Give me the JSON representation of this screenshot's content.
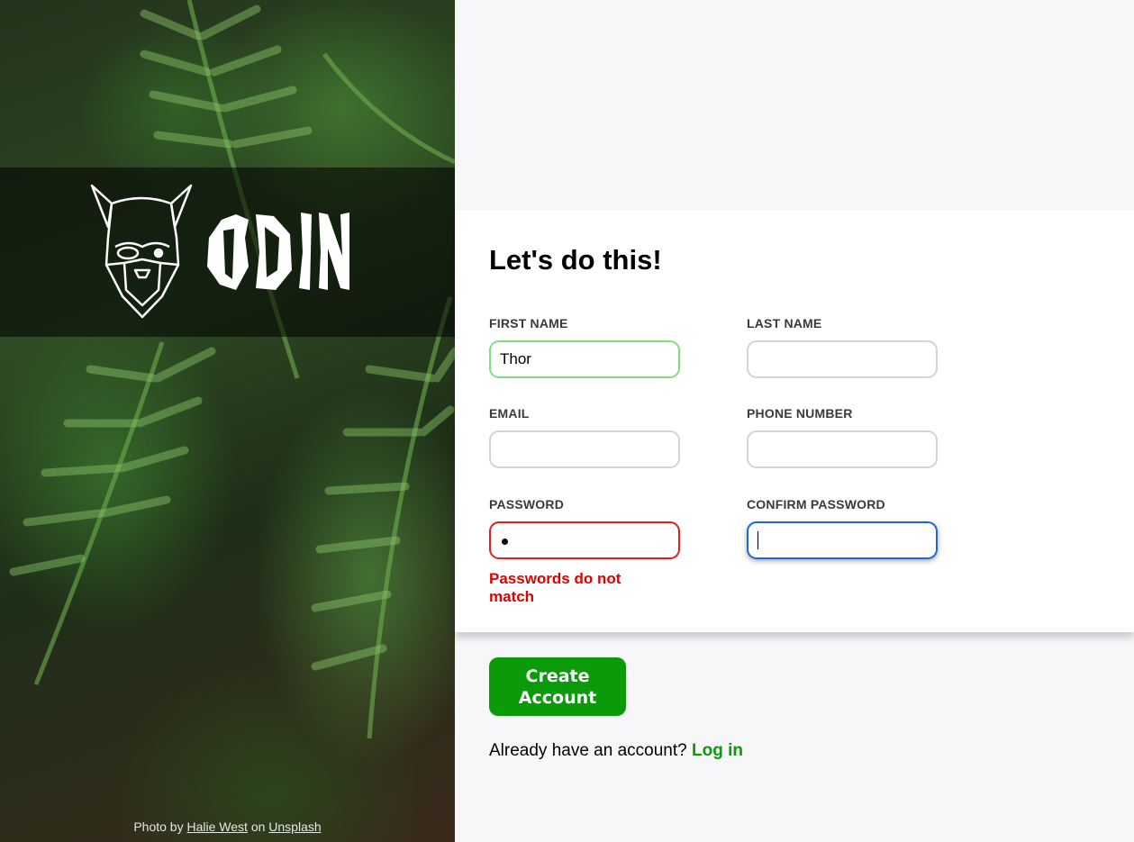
{
  "brand": {
    "name": "ODIN"
  },
  "photo_credit": {
    "prefix": "Photo by",
    "author": "Halie West",
    "middle": "on",
    "site": "Unsplash"
  },
  "form": {
    "heading": "Let's do this!",
    "fields": {
      "first_name": {
        "label": "FIRST NAME",
        "value": "Thor",
        "state": "valid"
      },
      "last_name": {
        "label": "LAST NAME",
        "value": ""
      },
      "email": {
        "label": "EMAIL",
        "value": ""
      },
      "phone": {
        "label": "PHONE NUMBER",
        "value": ""
      },
      "password": {
        "label": "PASSWORD",
        "value": "•",
        "state": "invalid"
      },
      "confirm_password": {
        "label": "CONFIRM PASSWORD",
        "value": "",
        "state": "focused"
      }
    },
    "error": "Passwords do not match"
  },
  "actions": {
    "create_label": "Create Account",
    "login_prompt": "Already have an account?",
    "login_link": "Log in"
  },
  "colors": {
    "accent": "#0a9a0a",
    "error": "#e00000",
    "focus": "#2266dd",
    "valid": "#7ee07e"
  }
}
